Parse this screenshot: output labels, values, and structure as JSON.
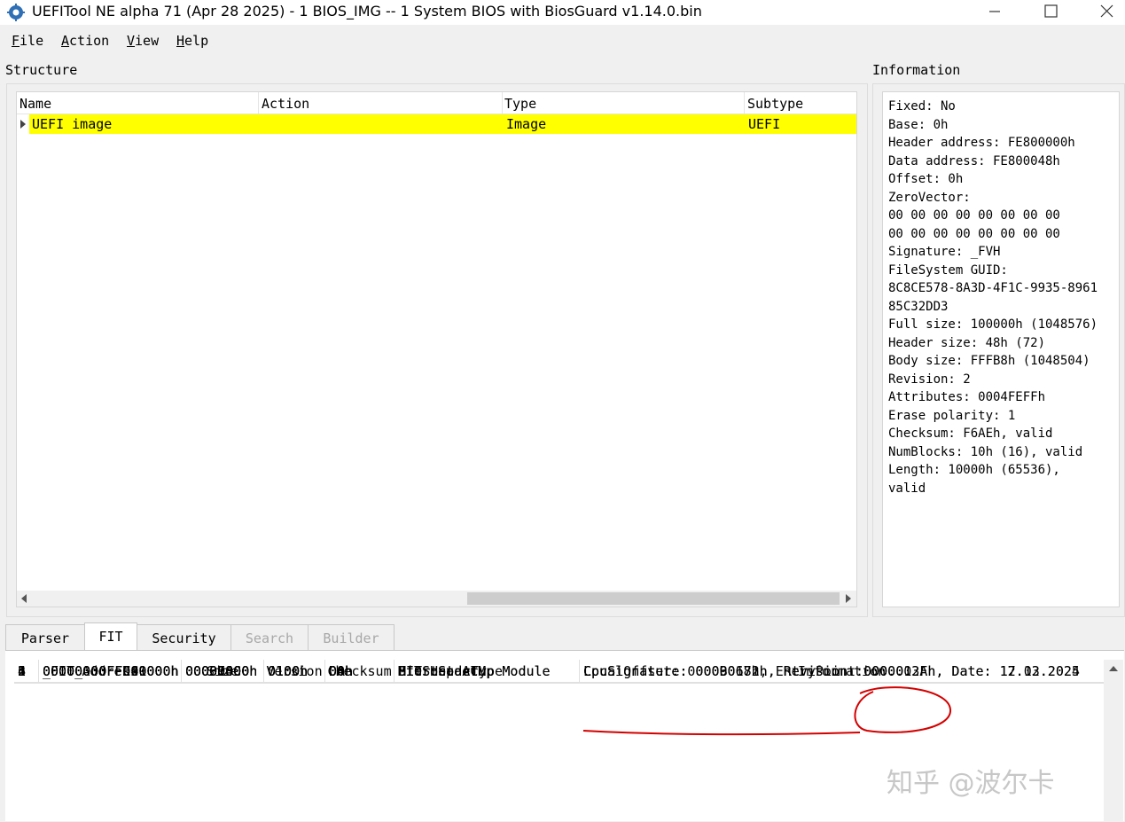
{
  "window": {
    "title": "UEFITool NE alpha 71 (Apr 28 2025) - 1 BIOS_IMG -- 1 System BIOS with BiosGuard v1.14.0.bin",
    "icon": "uefitool-app-icon"
  },
  "menu": [
    "File",
    "Action",
    "View",
    "Help"
  ],
  "structure": {
    "label": "Structure",
    "columns": [
      "Name",
      "Action",
      "Type",
      "Subtype"
    ],
    "rows": [
      {
        "name": "UEFI image",
        "action": "",
        "type": "Image",
        "subtype": "UEFI",
        "highlight": "#ffff00"
      }
    ]
  },
  "information": {
    "label": "Information",
    "text": "Fixed: No\nBase: 0h\nHeader address: FE800000h\nData address: FE800048h\nOffset: 0h\nZeroVector:\n00 00 00 00 00 00 00 00\n00 00 00 00 00 00 00 00\nSignature: _FVH\nFileSystem GUID:\n8C8CE578-8A3D-4F1C-9935-8961\n85C32DD3\nFull size: 100000h (1048576)\nHeader size: 48h (72)\nBody size: FFFB8h (1048504)\nRevision: 2\nAttributes: 0004FEFFh\nErase polarity: 1\nChecksum: F6AEh, valid\nNumBlocks: 10h (16), valid\nLength: 10000h (65536),\nvalid"
  },
  "tabs": [
    {
      "label": "Parser",
      "state": "normal"
    },
    {
      "label": "FIT",
      "state": "active"
    },
    {
      "label": "Security",
      "state": "normal"
    },
    {
      "label": "Search",
      "state": "disabled"
    },
    {
      "label": "Builder",
      "state": "disabled"
    }
  ],
  "fit": {
    "columns": [
      "Address",
      "Size",
      "Version",
      "Checksum",
      "Type",
      "Information"
    ],
    "rows": [
      {
        "n": "1",
        "address": "_FIT_",
        "size": "000000C0h",
        "version": "0100h",
        "checksum": "DAh",
        "type": "FIT Header",
        "info": ""
      },
      {
        "n": "2",
        "address": "00000000FFC01000h",
        "size": "00035800h",
        "version": "0100h",
        "checksum": "00h",
        "type": "Microcode",
        "info": "CpuSignature: 000B0671h, Revision: 0000012Fh, Date: 17.03.2025"
      },
      {
        "n": "3",
        "address": "00000000FFC49000h",
        "size": "00037400h",
        "version": "0100h",
        "checksum": "00h",
        "type": "Microcode",
        "info": "CpuSignature: 00090672h, Revision: 0000003Ah, Date: 12.12.2024"
      },
      {
        "n": "4",
        "address": "00000000FFD00000h",
        "size": "00009800h",
        "version": "0100h",
        "checksum": "00h",
        "type": "Startup ACM",
        "info": "LocalOffset: 00000018h, EntryPoint: 00..."
      },
      {
        "n": "5",
        "address": "00000000FFDC0000h",
        "size": "0000D000h",
        "version": "0100h",
        "checksum": "00h",
        "type": "BIOS Startup Module",
        "info": ""
      },
      {
        "n": "6",
        "address": "00000000FFE90000h",
        "size": "00001000h",
        "version": "0100h",
        "checksum": "00h",
        "type": "BIOS Startup Module",
        "info": ""
      }
    ]
  },
  "watermark": "知乎 @波尔卡",
  "annotation_color": "#d40000"
}
